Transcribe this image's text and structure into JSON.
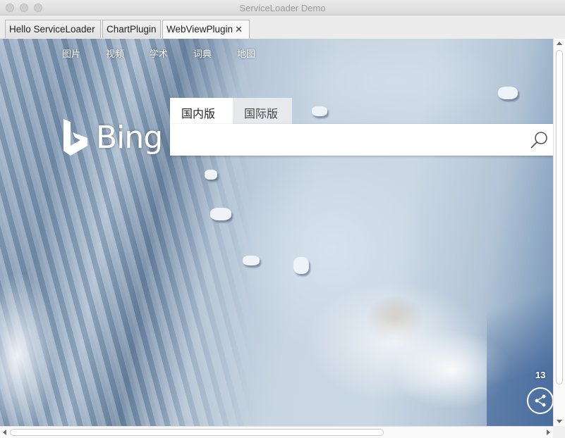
{
  "window": {
    "title": "ServiceLoader Demo"
  },
  "tabs": [
    {
      "label": "Hello ServiceLoader"
    },
    {
      "label": "ChartPlugin"
    },
    {
      "label": "WebViewPlugin",
      "close": "✕"
    }
  ],
  "bing": {
    "nav": [
      "图片",
      "视频",
      "学术",
      "词典",
      "地图"
    ],
    "logo_text": "Bing",
    "search_tabs": [
      "国内版",
      "国际版"
    ],
    "search": {
      "value": "",
      "placeholder": ""
    },
    "image_counter": "13"
  },
  "colors": {
    "accent_white": "#ffffff",
    "page_bg": "#ececec"
  },
  "icons": {
    "search": "search-icon",
    "share": "share-icon"
  }
}
